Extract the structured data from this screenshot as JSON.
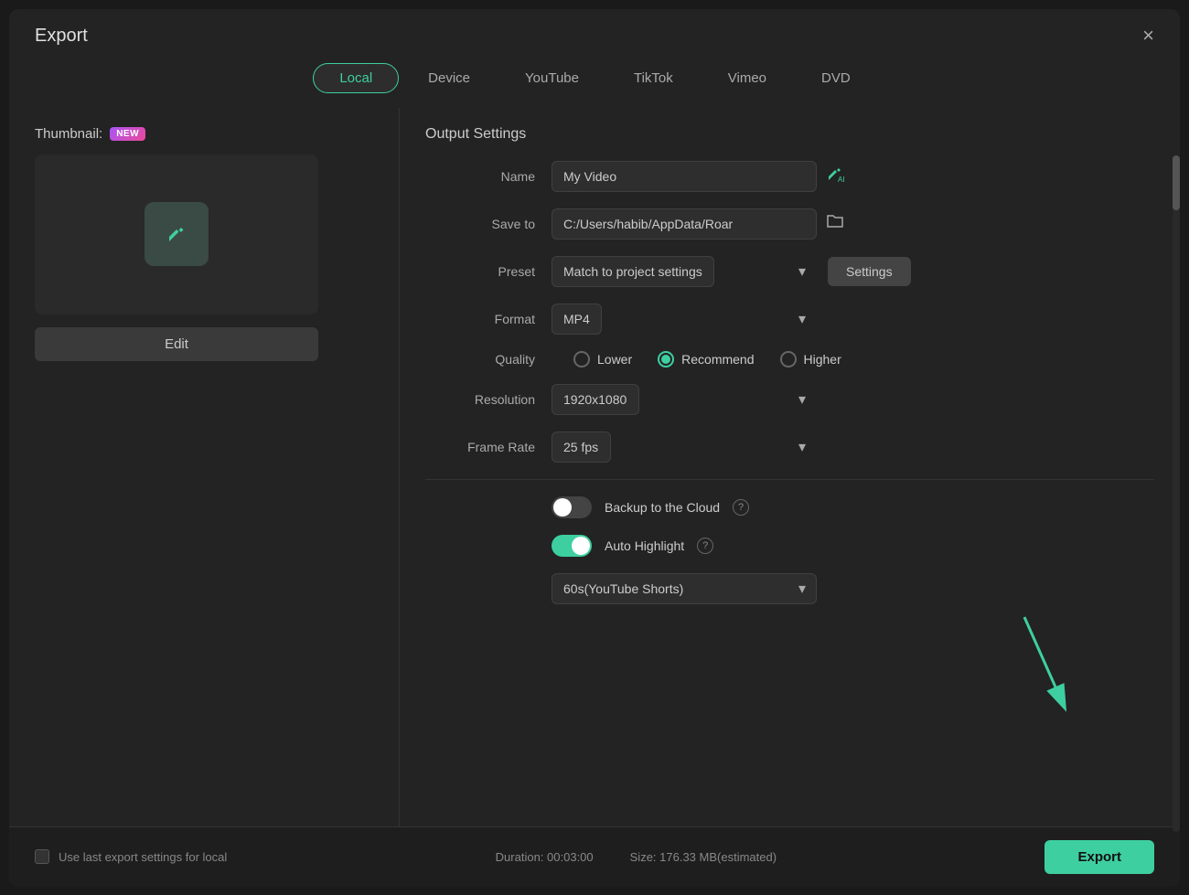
{
  "dialog": {
    "title": "Export",
    "close_label": "×"
  },
  "tabs": [
    {
      "id": "local",
      "label": "Local",
      "active": true
    },
    {
      "id": "device",
      "label": "Device",
      "active": false
    },
    {
      "id": "youtube",
      "label": "YouTube",
      "active": false
    },
    {
      "id": "tiktok",
      "label": "TikTok",
      "active": false
    },
    {
      "id": "vimeo",
      "label": "Vimeo",
      "active": false
    },
    {
      "id": "dvd",
      "label": "DVD",
      "active": false
    }
  ],
  "thumbnail": {
    "label": "Thumbnail:",
    "new_badge": "NEW",
    "edit_button": "Edit"
  },
  "output_settings": {
    "title": "Output Settings",
    "name_label": "Name",
    "name_value": "My Video",
    "save_to_label": "Save to",
    "save_to_value": "C:/Users/habib/AppData/Roar",
    "preset_label": "Preset",
    "preset_value": "Match to project settings",
    "settings_button": "Settings",
    "format_label": "Format",
    "format_value": "MP4",
    "quality_label": "Quality",
    "quality_options": [
      {
        "id": "lower",
        "label": "Lower",
        "checked": false
      },
      {
        "id": "recommend",
        "label": "Recommend",
        "checked": true
      },
      {
        "id": "higher",
        "label": "Higher",
        "checked": false
      }
    ],
    "resolution_label": "Resolution",
    "resolution_value": "1920x1080",
    "frame_rate_label": "Frame Rate",
    "frame_rate_value": "25 fps",
    "backup_label": "Backup to the Cloud",
    "backup_enabled": false,
    "auto_highlight_label": "Auto Highlight",
    "auto_highlight_enabled": true,
    "highlight_duration_value": "60s(YouTube Shorts)"
  },
  "footer": {
    "checkbox_label": "Use last export settings for local",
    "duration_label": "Duration: 00:03:00",
    "size_label": "Size: 176.33 MB(estimated)",
    "export_button": "Export"
  }
}
